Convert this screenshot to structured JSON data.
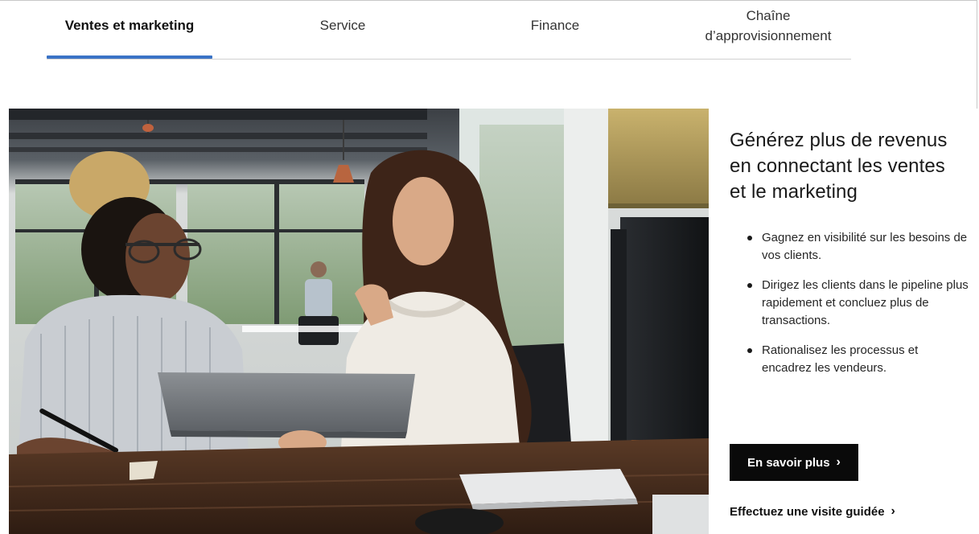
{
  "tabs": [
    {
      "label": "Ventes et marketing",
      "active": true
    },
    {
      "label": "Service",
      "active": false
    },
    {
      "label": "Finance",
      "active": false
    },
    {
      "label": "Chaîne d’approvisionnement",
      "active": false
    }
  ],
  "panel": {
    "headline": "Générez plus de revenus en connectant les ventes et le marketing",
    "bullets": [
      "Gagnez en visibilité sur les besoins de vos clients.",
      "Dirigez les clients dans le pipeline plus rapidement et concluez plus de transactions.",
      "Rationalisez les processus et encadrez les vendeurs."
    ],
    "cta_label": "En savoir plus",
    "link_label": "Effectuez une visite guidée",
    "chevron": "›"
  },
  "colors": {
    "accent": "#3a73c6",
    "cta_bg": "#0a0a0a"
  }
}
